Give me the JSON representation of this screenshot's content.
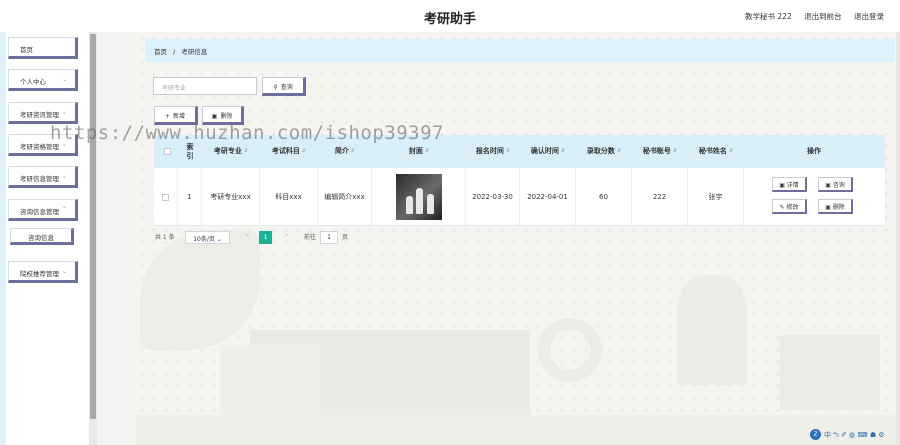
{
  "header": {
    "title": "考研助手",
    "links": [
      "教学秘书 222",
      "退出到前台",
      "退出登录"
    ]
  },
  "sidebar": {
    "items": [
      {
        "label": "首页",
        "has_chevron": false
      },
      {
        "label": "个人中心",
        "has_chevron": true
      },
      {
        "label": "考研资讯管理",
        "has_chevron": true
      },
      {
        "label": "考研资格管理",
        "has_chevron": true
      },
      {
        "label": "考研信息管理",
        "has_chevron": true
      },
      {
        "label": "咨询信息管理",
        "has_chevron": true
      },
      {
        "label": "院校推荐管理",
        "has_chevron": true
      }
    ],
    "subitem": {
      "label": "咨询信息"
    }
  },
  "breadcrumb": {
    "home": "首页",
    "sep": "/",
    "current": "考研信息"
  },
  "search": {
    "placeholder": "考研专业",
    "button": "查询",
    "add_button": "新增",
    "delete_button": "删除"
  },
  "watermark": "https://www.huzhan.com/ishop39397",
  "table": {
    "headers": [
      "索引",
      "考研专业",
      "考试科目",
      "简介",
      "封面",
      "报名时间",
      "确认时间",
      "录取分数",
      "秘书账号",
      "秘书姓名",
      "操作"
    ],
    "rows": [
      {
        "index": "1",
        "major": "考研专业xxx",
        "subject": "科目xxx",
        "intro": "编辑简介xxx",
        "signup_time": "2022-03-30",
        "confirm_time": "2022-04-01",
        "score": "60",
        "secretary_account": "222",
        "secretary_name": "张宇",
        "actions": [
          "详情",
          "咨询",
          "修改",
          "删除"
        ]
      }
    ]
  },
  "pagination": {
    "total": "共 1 条",
    "page_size": "10条/页",
    "prev": "<",
    "current_page": "1",
    "next": ">",
    "goto_label": "前往",
    "goto_value": "1",
    "page_suffix": "页"
  },
  "tray": {
    "logo": "Z",
    "glyphs": "中 ⁴₅ ✐ ◍ ⌨ ☗ ⚙"
  },
  "colors": {
    "accent": "#6d6d9e",
    "header_bg": "#d8eef9",
    "page_active": "#19b394"
  }
}
